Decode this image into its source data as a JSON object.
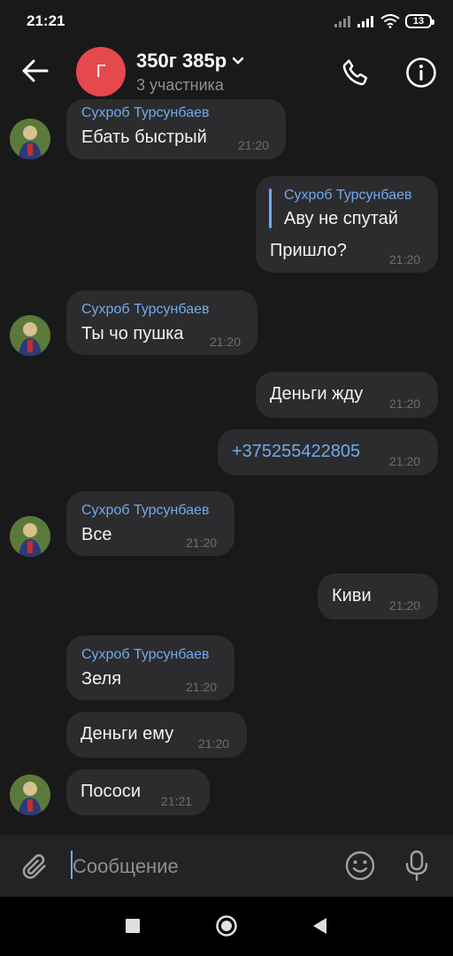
{
  "status_bar": {
    "time": "21:21",
    "battery": "13"
  },
  "header": {
    "avatar_letter": "Г",
    "title": "350г 385р",
    "subtitle": "3 участника"
  },
  "colors": {
    "accent": "#71aaeb",
    "bubble": "#2c2c2e",
    "background": "#19191a",
    "avatar_red": "#e5484d"
  },
  "messages": [
    {
      "direction": "in",
      "sender": "Сухроб Турсунбаев",
      "text": "Ебать быстрый",
      "time": "21:20",
      "avatar": true
    },
    {
      "direction": "out",
      "reply_to_sender": "Сухроб Турсунбаев",
      "reply_to_text": "Аву не спутай",
      "text": "Пришло?",
      "time": "21:20"
    },
    {
      "direction": "in",
      "sender": "Сухроб Турсунбаев",
      "text": "Ты чо пушка",
      "time": "21:20",
      "avatar": true
    },
    {
      "direction": "out",
      "text": "Деньги жду",
      "time": "21:20"
    },
    {
      "direction": "out",
      "text": "+375255422805",
      "time": "21:20",
      "is_link": true
    },
    {
      "direction": "in",
      "sender": "Сухроб Турсунбаев",
      "text": "Все",
      "time": "21:20",
      "avatar": true
    },
    {
      "direction": "out",
      "text": "Киви",
      "time": "21:20"
    },
    {
      "direction": "in",
      "sender": "Сухроб Турсунбаев",
      "text": "Зеля",
      "time": "21:20",
      "avatar": false
    },
    {
      "direction": "in",
      "text": "Деньги ему",
      "time": "21:20",
      "avatar": false
    },
    {
      "direction": "in",
      "text": "Пососи",
      "time": "21:21",
      "avatar": true
    }
  ],
  "composer": {
    "placeholder": "Сообщение"
  }
}
